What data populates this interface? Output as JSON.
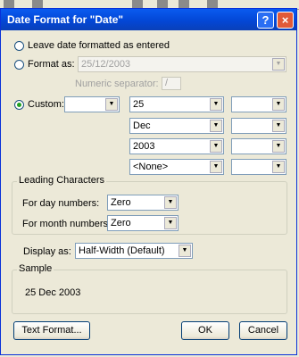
{
  "window": {
    "title": "Date Format for \"Date\"",
    "help_glyph": "?",
    "close_glyph": "×"
  },
  "options": {
    "leave_label": "Leave date formatted as entered",
    "format_as_label": "Format as:",
    "format_as_value": "25/12/2003",
    "numeric_separator_label": "Numeric separator:",
    "numeric_separator_value": "/",
    "custom_label": "Custom:",
    "selected": "custom"
  },
  "custom": {
    "prefix_value": "",
    "rows": [
      {
        "element": "25",
        "separator": ""
      },
      {
        "element": "Dec",
        "separator": ""
      },
      {
        "element": "2003",
        "separator": ""
      },
      {
        "element": "<None>",
        "separator": ""
      }
    ]
  },
  "leading_characters": {
    "legend": "Leading Characters",
    "day_label": "For day numbers:",
    "day_value": "Zero",
    "month_label": "For month numbers:",
    "month_value": "Zero"
  },
  "display": {
    "label": "Display as:",
    "value": "Half-Width (Default)"
  },
  "sample": {
    "legend": "Sample",
    "value": "25 Dec 2003"
  },
  "buttons": {
    "text_format": "Text Format...",
    "ok": "OK",
    "cancel": "Cancel"
  },
  "colors": {
    "title_bar": "#0347d6",
    "dialog_bg": "#ece9d8",
    "radio_dot": "#21a121"
  }
}
